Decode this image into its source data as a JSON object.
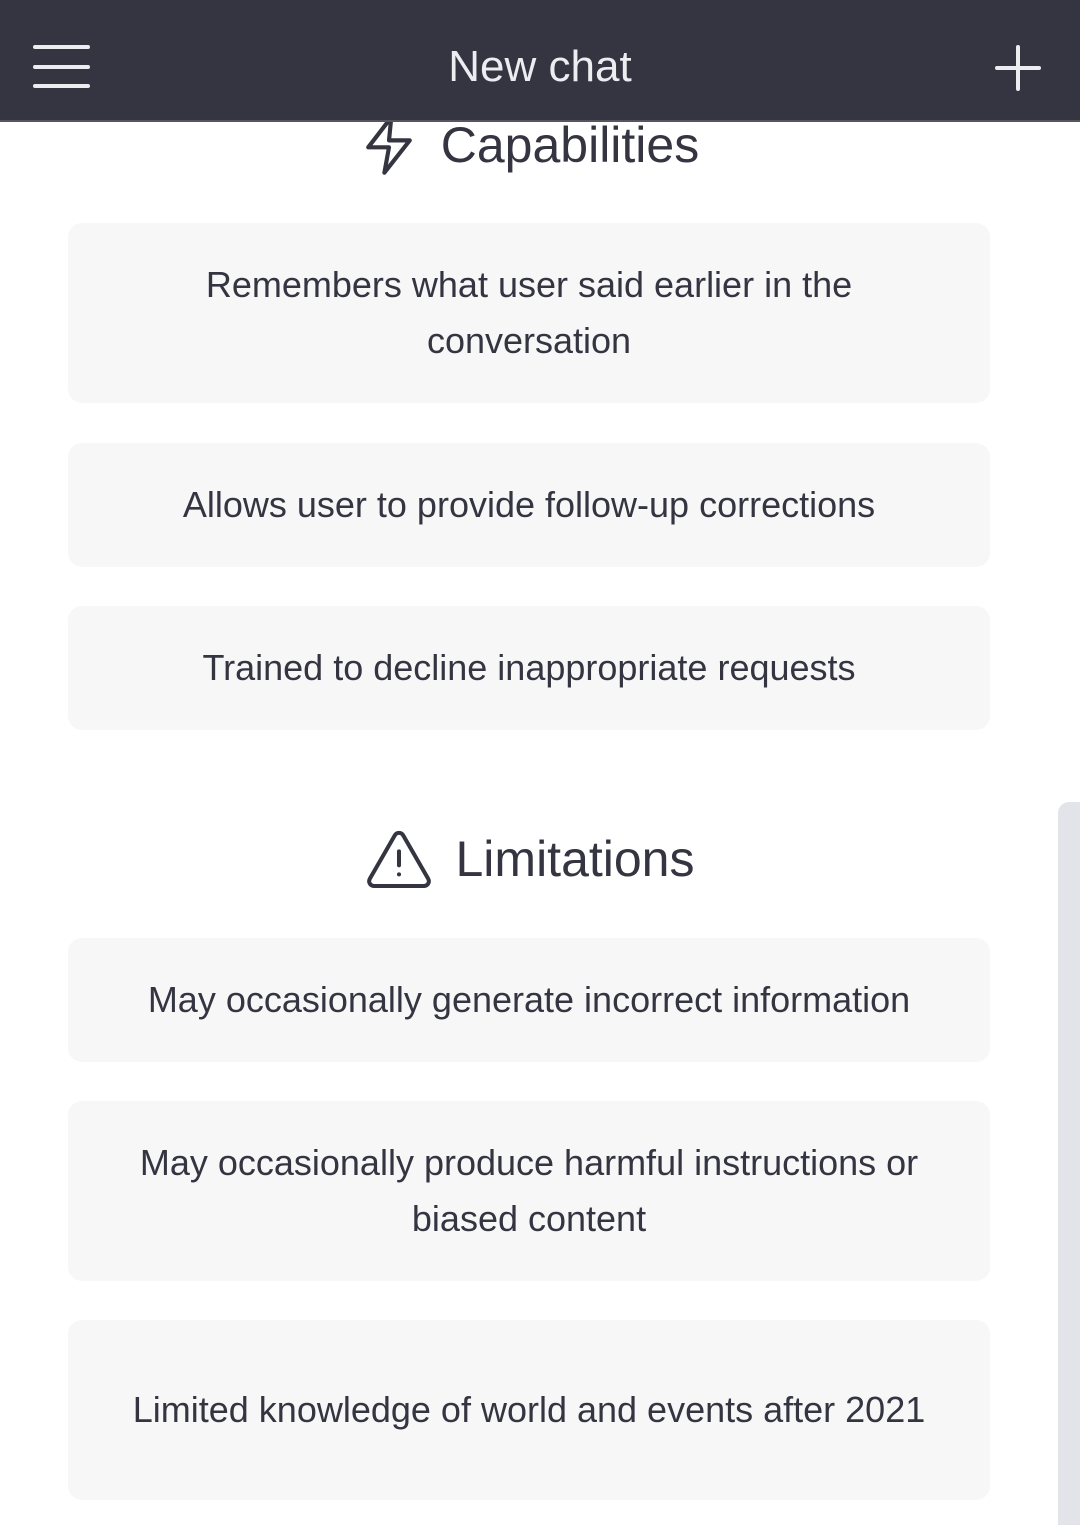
{
  "topbar": {
    "title": "New chat",
    "menu_icon": "hamburger-menu-icon",
    "new_chat_icon": "plus-icon",
    "background": "#343541"
  },
  "capabilities": {
    "heading": "Capabilities",
    "icon": "lightning-bolt-icon",
    "items": [
      {
        "text": "Remembers what user said earlier in the conversation"
      },
      {
        "text": "Allows user to provide follow-up corrections"
      },
      {
        "text": "Trained to decline inappropriate requests"
      }
    ]
  },
  "limitations": {
    "heading": "Limitations",
    "icon": "warning-triangle-icon",
    "items": [
      {
        "text": "May occasionally generate incorrect information"
      },
      {
        "text": "May occasionally produce harmful instructions or biased content"
      },
      {
        "text": "Limited knowledge of world and events after 2021"
      }
    ]
  },
  "colors": {
    "card_background": "#f7f7f8",
    "text": "#343541"
  }
}
